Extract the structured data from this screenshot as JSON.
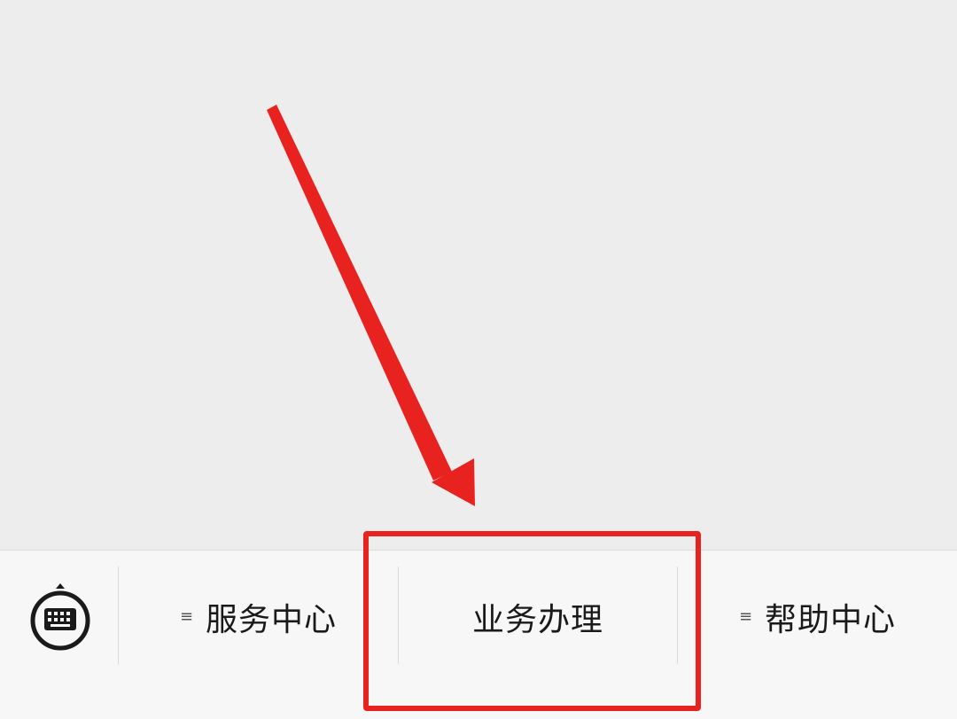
{
  "menu": {
    "items": [
      {
        "label": "服务中心",
        "has_submenu": true
      },
      {
        "label": "业务办理",
        "has_submenu": false
      },
      {
        "label": "帮助中心",
        "has_submenu": true
      }
    ]
  },
  "icons": {
    "keyboard_toggle": "keyboard-icon",
    "submenu_marker": "hamburger-icon"
  },
  "colors": {
    "annotation": "#e8231f",
    "background": "#ededed",
    "menu_bar": "#f7f7f7"
  }
}
